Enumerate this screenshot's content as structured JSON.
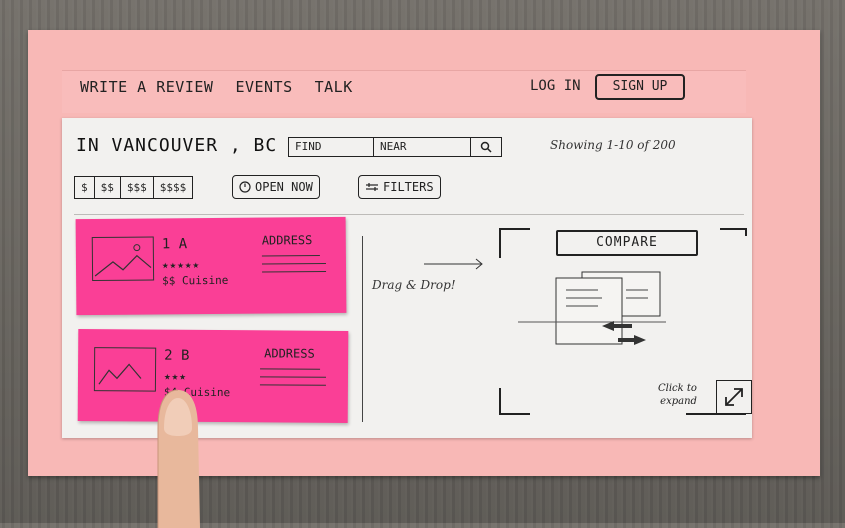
{
  "nav": {
    "write_review": "WRITE A REVIEW",
    "events": "EVENTS",
    "talk": "TALK",
    "login": "LOG IN",
    "signup": "SIGN UP"
  },
  "location": "IN VANCOUVER , BC",
  "search": {
    "find_placeholder": "FIND",
    "near_placeholder": "NEAR",
    "icon": "search-icon"
  },
  "results_count": "Showing 1-10 of 200",
  "filters": {
    "prices": [
      "$",
      "$$",
      "$$$",
      "$$$$"
    ],
    "open_now": "OPEN NOW",
    "filters": "FILTERS"
  },
  "results": [
    {
      "name": "1  A",
      "stars": "★★★★★",
      "cuisine": "$$ Cuisine",
      "address": "ADDRESS"
    },
    {
      "name": "2  B",
      "stars": "★★★",
      "cuisine": "$4  Cuisine",
      "address": "ADDRESS"
    }
  ],
  "compare": {
    "drag_drop": "Drag & Drop!",
    "button": "COMPARE",
    "expand_line1": "Click to",
    "expand_line2": "expand"
  },
  "colors": {
    "paper": "#f8b8b6",
    "sticky": "#fa3f96",
    "sheet": "#f2f1ef",
    "ink": "#222222"
  }
}
